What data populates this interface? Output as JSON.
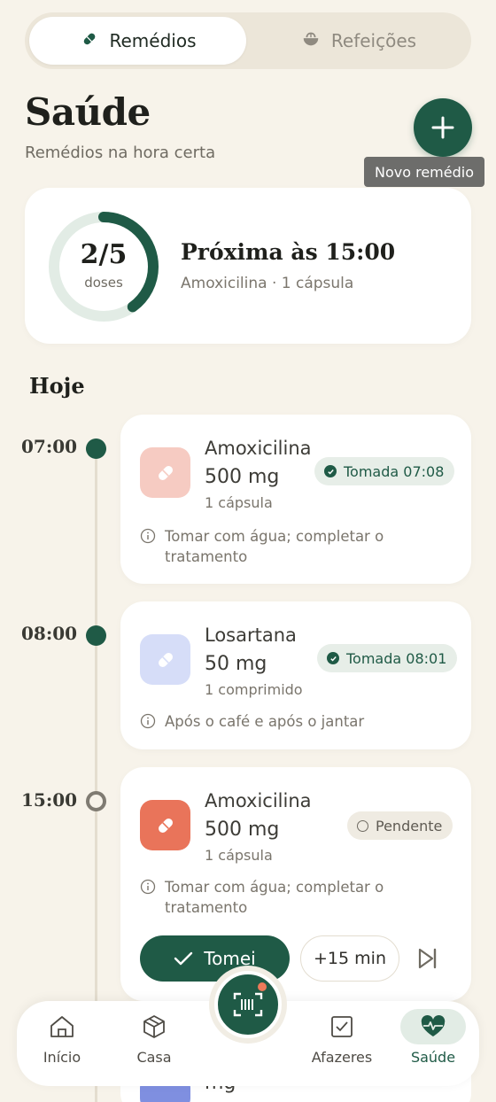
{
  "tabs": [
    {
      "label": "Remédios",
      "icon": "pill-icon",
      "active": true
    },
    {
      "label": "Refeições",
      "icon": "bowl-icon",
      "active": false
    }
  ],
  "header": {
    "title": "Saúde",
    "subtitle": "Remédios na hora certa",
    "add_tooltip": "Novo remédio"
  },
  "summary": {
    "taken_count": "2/5",
    "taken_label": "doses",
    "progress": 0.4,
    "next_title": "Próxima às 15:00",
    "next_detail": "Amoxicilina · 1 cápsula"
  },
  "section_title": "Hoje",
  "doses": [
    {
      "time": "07:00",
      "name": "Amoxicilina",
      "dose": "500 mg",
      "unit": "1 cápsula",
      "status": "Tomada 07:08",
      "note": "Tomar com água; completar o tratamento",
      "color": "#f6cbc2",
      "state": "taken"
    },
    {
      "time": "08:00",
      "name": "Losartana",
      "dose": "50 mg",
      "unit": "1 comprimido",
      "status": "Tomada 08:01",
      "note": "Após o café e após o jantar",
      "color": "#d6ddf8",
      "state": "taken"
    },
    {
      "time": "15:00",
      "name": "Amoxicilina",
      "dose": "500 mg",
      "unit": "1 cápsula",
      "status": "Pendente",
      "note": "Tomar com água; completar o tratamento",
      "color": "#e9745a",
      "state": "pending"
    }
  ],
  "actions": {
    "took": "Tomei",
    "snooze": "+15 min"
  },
  "peek": {
    "dose_fragment": "mg"
  },
  "nav": [
    {
      "label": "Início",
      "icon": "home-icon"
    },
    {
      "label": "Casa",
      "icon": "box-icon"
    },
    {
      "label": "Afazeres",
      "icon": "checkbox-icon"
    },
    {
      "label": "Saúde",
      "icon": "heartbeat-icon",
      "active": true
    }
  ],
  "colors": {
    "accent": "#1f5a46",
    "background": "#f7f3ea",
    "alert": "#ec7a5a"
  }
}
